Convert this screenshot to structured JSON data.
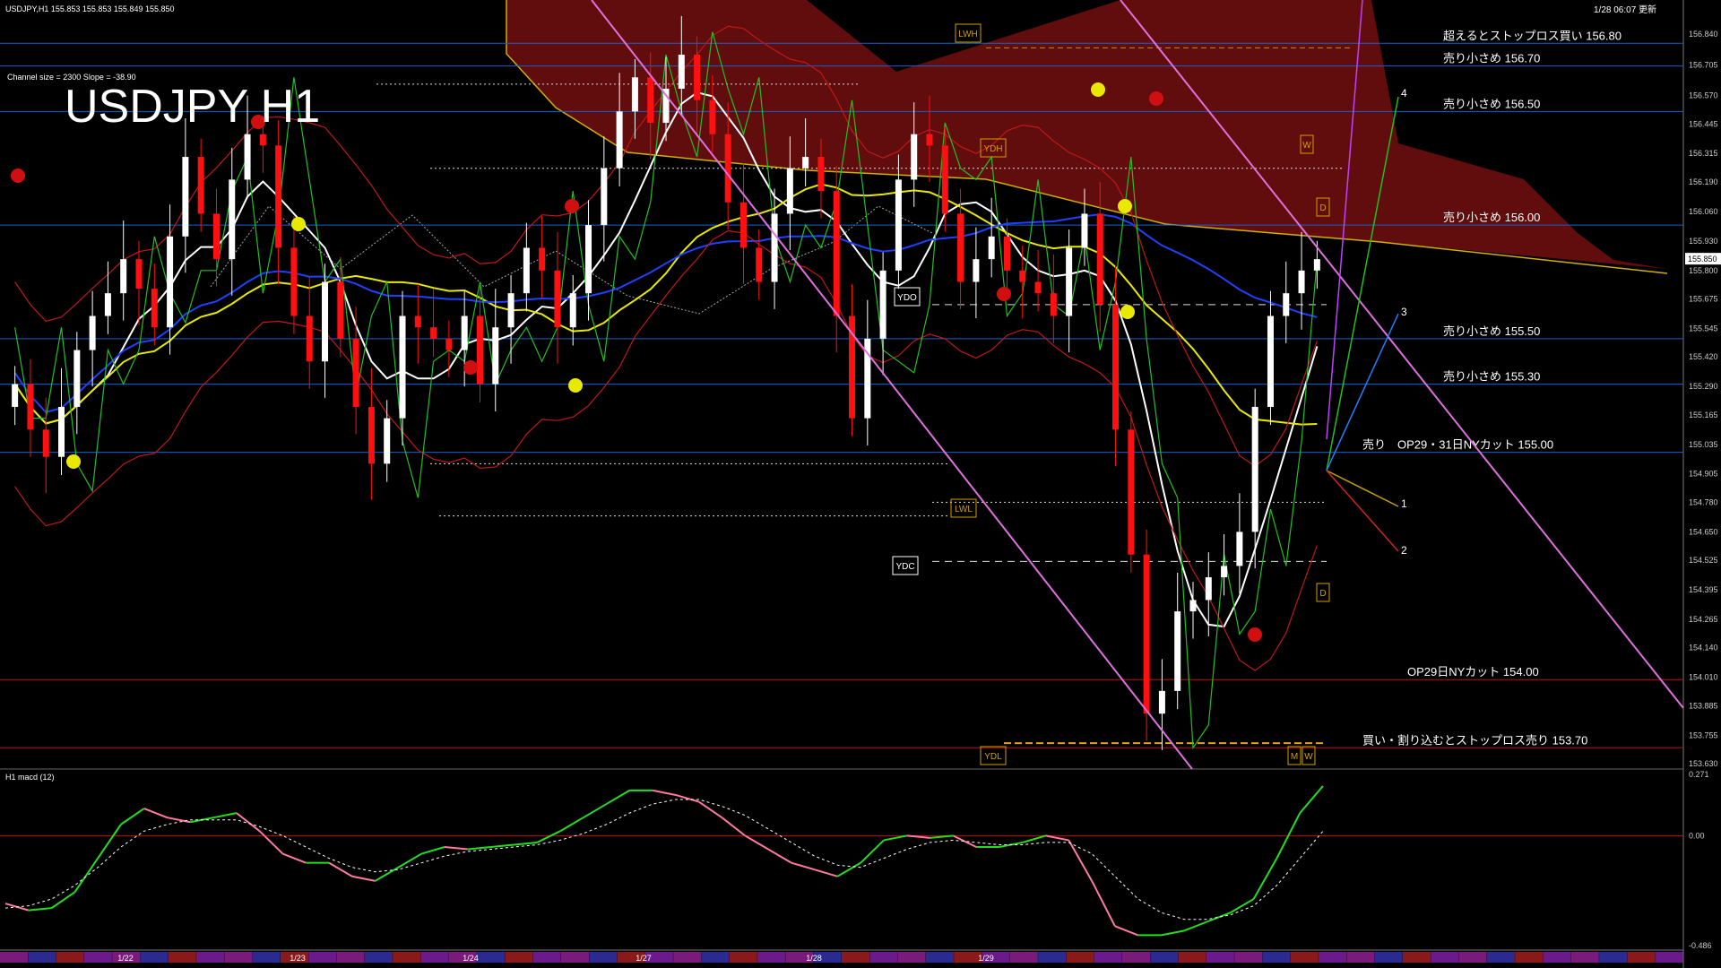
{
  "header": {
    "symbol_line": "USDJPY,H1  155.853 155.853 155.849 155.850",
    "channel_info": "Channel size = 2300 Slope = -38.90",
    "big_title": "USDJPY H1",
    "timestamp": "1/28 06:07 更新",
    "macd_label": "H1  macd (12)"
  },
  "colors": {
    "background": "#000000",
    "bull_candle": "#ffffff",
    "bear_candle": "#ff1010",
    "level_line": "#1a5fd0",
    "cut_line": "#c01010",
    "channel": "#e070e0",
    "sma_white": "#ffffff",
    "sma_yellow": "#e8e800",
    "sma_blue": "#2040ff",
    "cloud": "#b01818",
    "macd_up": "#22dd22",
    "macd_down": "#ff7aa0"
  },
  "chart_data": [
    {
      "type": "candlestick",
      "title": "USDJPY H1",
      "ylim": [
        153.63,
        156.88
      ],
      "y_ticks": [
        "156.840",
        "156.705",
        "156.570",
        "156.445",
        "156.315",
        "156.190",
        "156.060",
        "155.930",
        "155.800",
        "155.675",
        "155.545",
        "155.420",
        "155.290",
        "155.165",
        "155.035",
        "154.905",
        "154.780",
        "154.650",
        "154.525",
        "154.395",
        "154.265",
        "154.140",
        "154.010",
        "153.885",
        "153.755",
        "153.630"
      ],
      "current_price": "155.850",
      "x_date_labels": [
        "1/22",
        "1/23",
        "1/24",
        "1/27",
        "1/28",
        "1/29"
      ],
      "close_series": [
        155.3,
        155.1,
        154.98,
        155.2,
        155.45,
        155.6,
        155.7,
        155.85,
        155.72,
        155.55,
        155.95,
        156.3,
        156.05,
        155.85,
        156.2,
        156.4,
        156.35,
        155.9,
        155.6,
        155.4,
        155.75,
        155.5,
        155.2,
        154.95,
        155.15,
        155.6,
        155.55,
        155.5,
        155.45,
        155.6,
        155.3,
        155.55,
        155.7,
        155.9,
        155.8,
        155.55,
        155.7,
        156.0,
        156.25,
        156.5,
        156.65,
        156.45,
        156.6,
        156.75,
        156.55,
        156.4,
        156.1,
        155.9,
        155.75,
        156.05,
        156.25,
        156.3,
        156.15,
        155.6,
        155.15,
        155.5,
        155.8,
        156.2,
        156.4,
        156.35,
        156.05,
        155.75,
        155.85,
        155.95,
        155.8,
        155.75,
        155.7,
        155.6,
        155.9,
        156.05,
        155.65,
        155.1,
        154.55,
        153.85,
        153.95,
        154.3,
        154.35,
        154.45,
        154.5,
        154.65,
        155.2,
        155.6,
        155.7,
        155.8,
        155.85
      ],
      "levels": [
        {
          "price": 156.8,
          "label": "超えるとストップロス買い 156.80",
          "kind": "blue"
        },
        {
          "price": 156.7,
          "label": "売り小さめ 156.70",
          "kind": "blue"
        },
        {
          "price": 156.5,
          "label": "売り小さめ 156.50",
          "kind": "blue"
        },
        {
          "price": 156.0,
          "label": "売り小さめ 156.00",
          "kind": "blue"
        },
        {
          "price": 155.5,
          "label": "売り小さめ 155.50",
          "kind": "blue"
        },
        {
          "price": 155.3,
          "label": "売り小さめ 155.30",
          "kind": "blue"
        },
        {
          "price": 155.0,
          "label": "売り　OP29・31日NYカット 155.00",
          "kind": "blue"
        },
        {
          "price": 154.0,
          "label": "OP29日NYカット 154.00",
          "kind": "red"
        },
        {
          "price": 153.7,
          "label": "買い・割り込むとストップロス売り 153.70",
          "kind": "red"
        }
      ],
      "markers": [
        "LWH",
        "YDH",
        "YDO",
        "LWL",
        "YDC",
        "YDL",
        "W",
        "D",
        "D",
        "M",
        "W"
      ],
      "projection_labels": [
        "4",
        "3",
        "1",
        "2"
      ]
    },
    {
      "type": "line",
      "title": "H1  macd (12)",
      "ylim": [
        -0.486,
        0.271
      ],
      "y_ticks": [
        "0.271",
        "0.00",
        "-0.486"
      ],
      "macd": [
        -0.3,
        -0.33,
        -0.32,
        -0.25,
        -0.1,
        0.05,
        0.12,
        0.08,
        0.06,
        0.08,
        0.1,
        0.02,
        -0.08,
        -0.12,
        -0.12,
        -0.18,
        -0.2,
        -0.14,
        -0.08,
        -0.05,
        -0.06,
        -0.05,
        -0.04,
        -0.03,
        0.02,
        0.08,
        0.14,
        0.2,
        0.2,
        0.18,
        0.15,
        0.08,
        0.0,
        -0.06,
        -0.12,
        -0.15,
        -0.18,
        -0.12,
        -0.02,
        0.0,
        -0.01,
        0.0,
        -0.05,
        -0.05,
        -0.03,
        0.0,
        -0.02,
        -0.2,
        -0.4,
        -0.44,
        -0.44,
        -0.42,
        -0.38,
        -0.34,
        -0.28,
        -0.1,
        0.1,
        0.22
      ],
      "signal": [
        -0.32,
        -0.31,
        -0.28,
        -0.22,
        -0.14,
        -0.05,
        0.02,
        0.05,
        0.07,
        0.07,
        0.07,
        0.04,
        0.0,
        -0.05,
        -0.1,
        -0.14,
        -0.16,
        -0.15,
        -0.12,
        -0.09,
        -0.07,
        -0.06,
        -0.05,
        -0.04,
        -0.02,
        0.01,
        0.05,
        0.1,
        0.14,
        0.16,
        0.16,
        0.13,
        0.09,
        0.03,
        -0.03,
        -0.09,
        -0.13,
        -0.14,
        -0.1,
        -0.06,
        -0.03,
        -0.02,
        -0.03,
        -0.04,
        -0.04,
        -0.03,
        -0.03,
        -0.08,
        -0.18,
        -0.28,
        -0.34,
        -0.37,
        -0.37,
        -0.35,
        -0.31,
        -0.22,
        -0.1,
        0.02
      ]
    }
  ]
}
